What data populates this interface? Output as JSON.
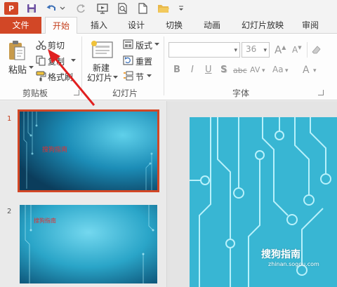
{
  "app": {
    "logo": "P"
  },
  "quick_access": {
    "icons": [
      "save-icon",
      "undo-icon",
      "undo-dropdown-icon",
      "redo-icon",
      "from-beginning-icon",
      "print-preview-icon",
      "new-icon",
      "open-icon",
      "customize-icon"
    ]
  },
  "tabs": {
    "file": "文件",
    "items": [
      "开始",
      "插入",
      "设计",
      "切换",
      "动画",
      "幻灯片放映",
      "审阅"
    ],
    "active_index": 0
  },
  "ribbon": {
    "clipboard": {
      "paste": "粘贴",
      "cut": "剪切",
      "copy": "复制",
      "format_painter": "格式刷",
      "group_label": "剪贴板"
    },
    "slides": {
      "new_slide_line1": "新建",
      "new_slide_line2": "幻灯片",
      "layout": "版式",
      "reset": "重置",
      "section": "节",
      "group_label": "幻灯片"
    },
    "font": {
      "font_name": "",
      "font_size": "36",
      "grow": "A",
      "shrink": "A",
      "bold": "B",
      "italic": "I",
      "underline": "U",
      "shadow": "S",
      "strikethrough": "abc",
      "spacing": "AV",
      "change_case": "Aa",
      "font_color": "A",
      "group_label": "字体"
    }
  },
  "slides_panel": {
    "slides": [
      {
        "number": "1",
        "title": "搜狗指南",
        "selected": true
      },
      {
        "number": "2",
        "title": "搜狗指南",
        "selected": false
      }
    ]
  },
  "watermark": {
    "main": "搜狗指南",
    "sub": "zhinan.sogou.com"
  },
  "colors": {
    "accent": "#d24726",
    "active_tab_text": "#c43e1c",
    "slide_bg": "#38b6d3",
    "thumb_dark": "#0b3d5c",
    "thumb_title": "#e03030"
  }
}
